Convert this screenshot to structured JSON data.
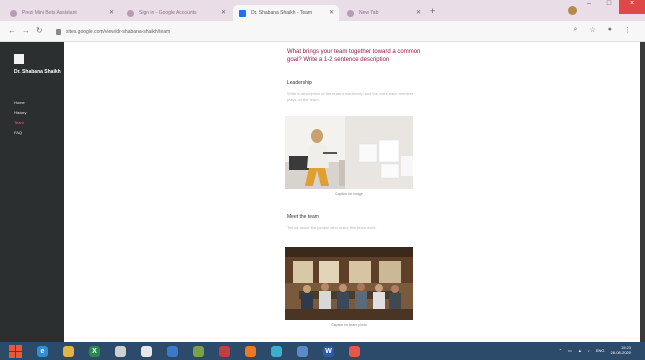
{
  "browser": {
    "tabs": [
      {
        "label": "Prezi Mini Bots Assistant",
        "active": false
      },
      {
        "label": "Sign in - Google Accounts",
        "active": false
      },
      {
        "label": "Dr. Shabana Shaikh - Team",
        "active": true
      },
      {
        "label": "New Tab",
        "active": false
      }
    ],
    "new_tab_glyph": "+",
    "url": "sites.google.com/view/dr-shabana-shaikh/team",
    "window_buttons": [
      "–",
      "□",
      "×"
    ]
  },
  "site": {
    "title": "Dr. Shabana Shaikh",
    "nav": [
      {
        "label": "Home",
        "active": false
      },
      {
        "label": "History",
        "active": false
      },
      {
        "label": "Team",
        "active": true
      },
      {
        "label": "FAQ",
        "active": false
      }
    ]
  },
  "main": {
    "question": "What brings your team together toward a common goal? Write a 1-2 sentence description",
    "section1": {
      "heading": "Leadership",
      "text": "Write a description of the team's leadership and the roles each member plays on the team.",
      "caption": "Caption for image"
    },
    "section2": {
      "heading": "Meet the team",
      "text": "Tell us about the people who make this team work.",
      "caption": "Caption for team photo"
    }
  },
  "taskbar": {
    "apps": [
      {
        "icon": "edge-icon",
        "color": "#2d8fd6",
        "glyph": "e"
      },
      {
        "icon": "folder-icon",
        "color": "#e3b34a",
        "glyph": ""
      },
      {
        "icon": "excel-icon",
        "color": "#2a8a4a",
        "glyph": "X"
      },
      {
        "icon": "paint-icon",
        "color": "#d0d0d0",
        "glyph": ""
      },
      {
        "icon": "chrome-icon",
        "color": "#e8e8e8",
        "glyph": ""
      },
      {
        "icon": "store-icon",
        "color": "#3a7ac8",
        "glyph": ""
      },
      {
        "icon": "tool-icon",
        "color": "#7aa04a",
        "glyph": ""
      },
      {
        "icon": "security-icon",
        "color": "#c04040",
        "glyph": ""
      },
      {
        "icon": "firefox-icon",
        "color": "#e87a2a",
        "glyph": ""
      },
      {
        "icon": "camera-icon",
        "color": "#3ab0d0",
        "glyph": ""
      },
      {
        "icon": "people-icon",
        "color": "#5a8ac8",
        "glyph": ""
      },
      {
        "icon": "word-icon",
        "color": "#2b5aa8",
        "glyph": "W"
      },
      {
        "icon": "chrome-active-icon",
        "color": "#e05a4a",
        "glyph": ""
      }
    ],
    "lang": "ENG",
    "time": "15:23",
    "date": "28-08-2020"
  }
}
